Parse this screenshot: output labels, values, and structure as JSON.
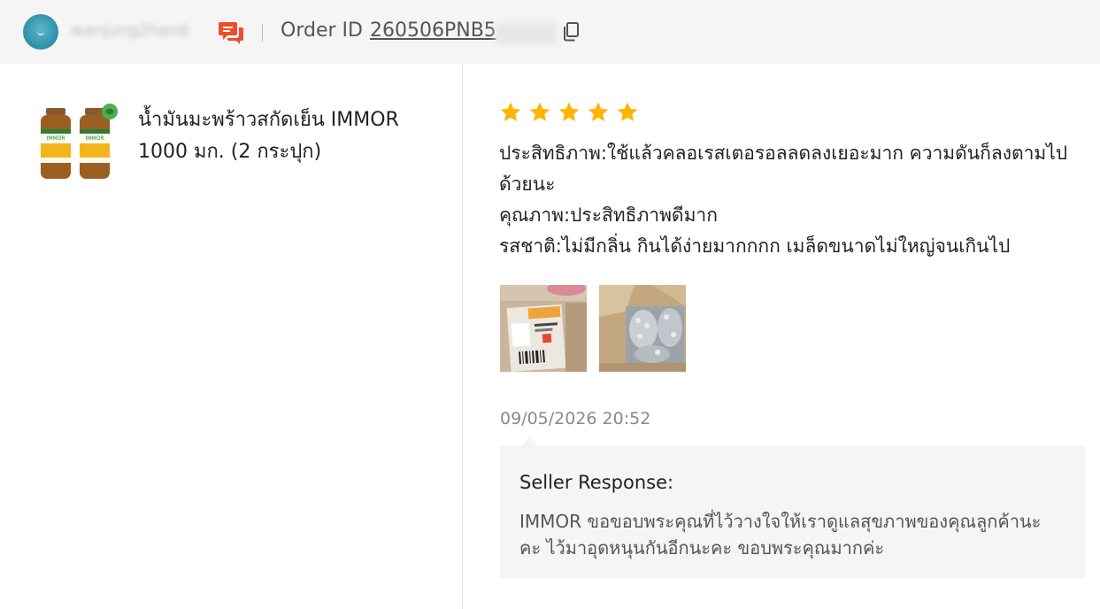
{
  "header": {
    "username": "wanjung2hand",
    "order_label": "Order ID",
    "order_id": "260506PNB5",
    "icons": {
      "avatar": "avatar",
      "chat": "chat-icon",
      "copy": "copy-icon"
    },
    "chat_color": "#ee4d2d"
  },
  "product": {
    "name_line1": "น้ำมันมะพร้าวสกัดเย็น IMMOR",
    "name_line2": "1000 มก. (2 กระปุก)",
    "thumb_label": "IMMOR"
  },
  "review": {
    "rating": 5,
    "max_rating": 5,
    "star_color": "#ffb400",
    "lines": [
      "ประสิทธิภาพ:ใช้แล้วคลอเรสเตอรอลลดลงเยอะมาก ความดันก็ลงตามไปด้วยนะ",
      "คุณภาพ:ประสิทธิภาพดีมาก",
      "รสชาติ:ไม่มีกลิ่น กินได้ง่ายมากกกก เมล็ดขนาดไม่ใหญ่จนเกินไป"
    ],
    "photos": [
      "review-photo-parcel-label",
      "review-photo-bubble-wrap"
    ],
    "time": "09/05/2026 20:52"
  },
  "seller_response": {
    "title": "Seller Response:",
    "text": "IMMOR ขอขอบพระคุณที่ไว้วางใจให้เราดูแลสุขภาพของคุณลูกค้านะคะ ไว้มาอุดหนุนกันอีกนะคะ ขอบพระคุณมากค่ะ"
  }
}
